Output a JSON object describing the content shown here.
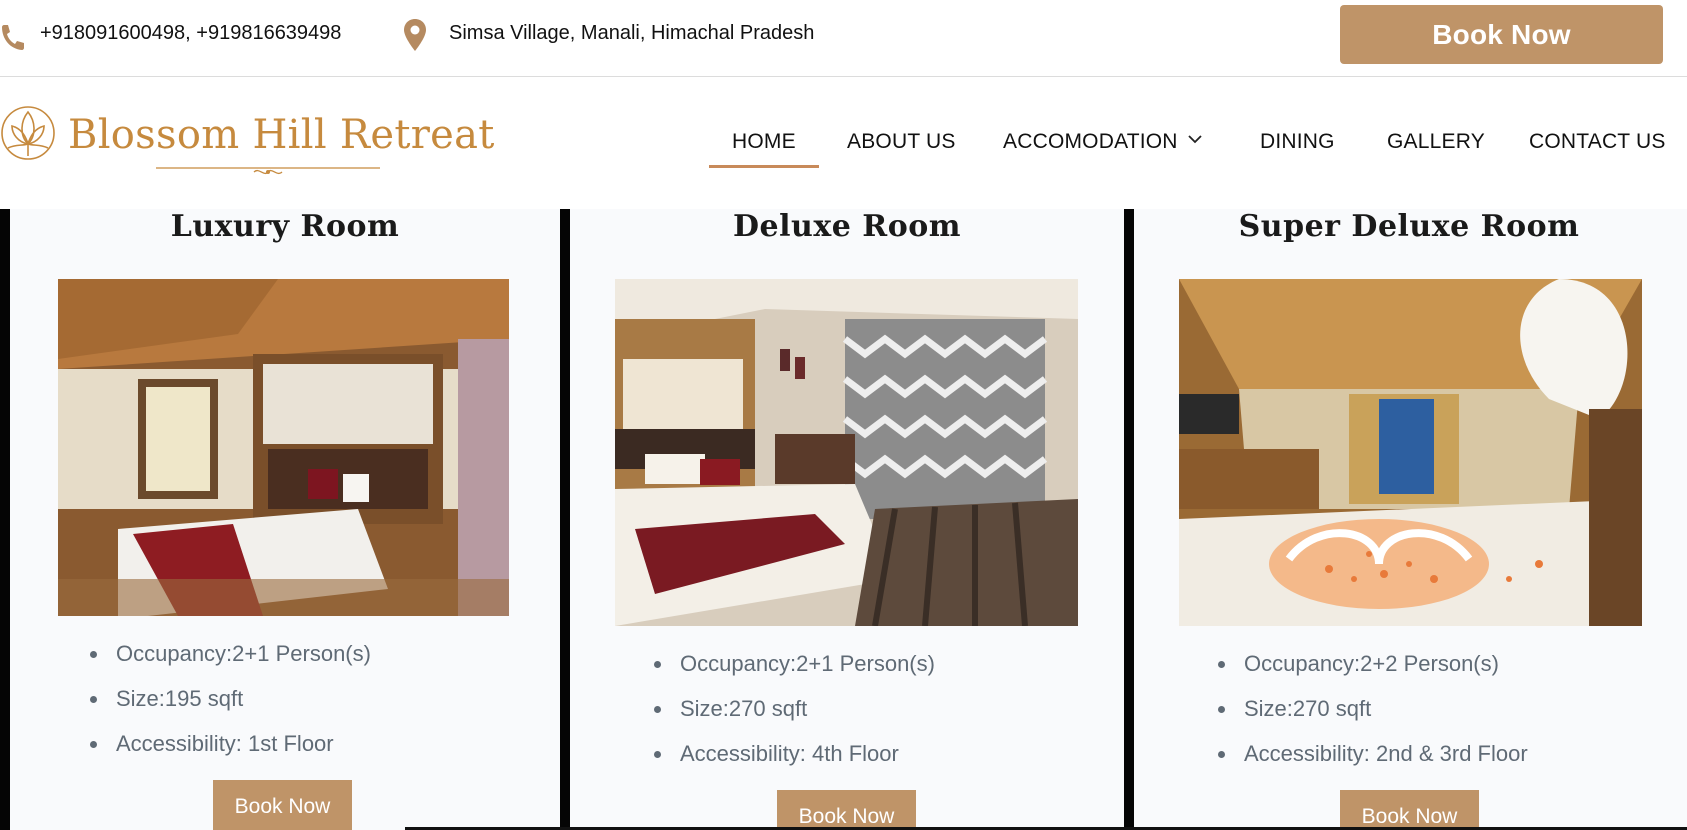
{
  "topbar": {
    "phones": "+918091600498, +919816639498",
    "address": "Simsa Village, Manali, Himachal Pradesh",
    "book_label": "Book Now"
  },
  "brand": {
    "name": "Blossom Hill Retreat",
    "accent_color": "#c68a3e",
    "button_color": "#bf9468"
  },
  "nav": {
    "items": [
      {
        "label": "HOME",
        "active": true
      },
      {
        "label": "ABOUT US",
        "active": false
      },
      {
        "label": "ACCOMODATION",
        "active": false,
        "has_dropdown": true
      },
      {
        "label": "DINING",
        "active": false
      },
      {
        "label": "GALLERY",
        "active": false
      },
      {
        "label": "CONTACT US",
        "active": false
      }
    ]
  },
  "rooms": [
    {
      "title": "Luxury Room",
      "image": "room-photo-luxury",
      "specs": [
        "Occupancy:2+1 Person(s)",
        "Size:195 sqft",
        "Accessibility: 1st Floor"
      ],
      "book_label": "Book Now"
    },
    {
      "title": "Deluxe Room",
      "image": "room-photo-deluxe",
      "specs": [
        "Occupancy:2+1 Person(s)",
        "Size:270 sqft",
        "Accessibility: 4th Floor"
      ],
      "book_label": "Book Now"
    },
    {
      "title": "Super Deluxe Room",
      "image": "room-photo-super-deluxe",
      "specs": [
        "Occupancy:2+2 Person(s)",
        "Size:270 sqft",
        "Accessibility: 2nd & 3rd Floor"
      ],
      "book_label": "Book Now"
    }
  ]
}
